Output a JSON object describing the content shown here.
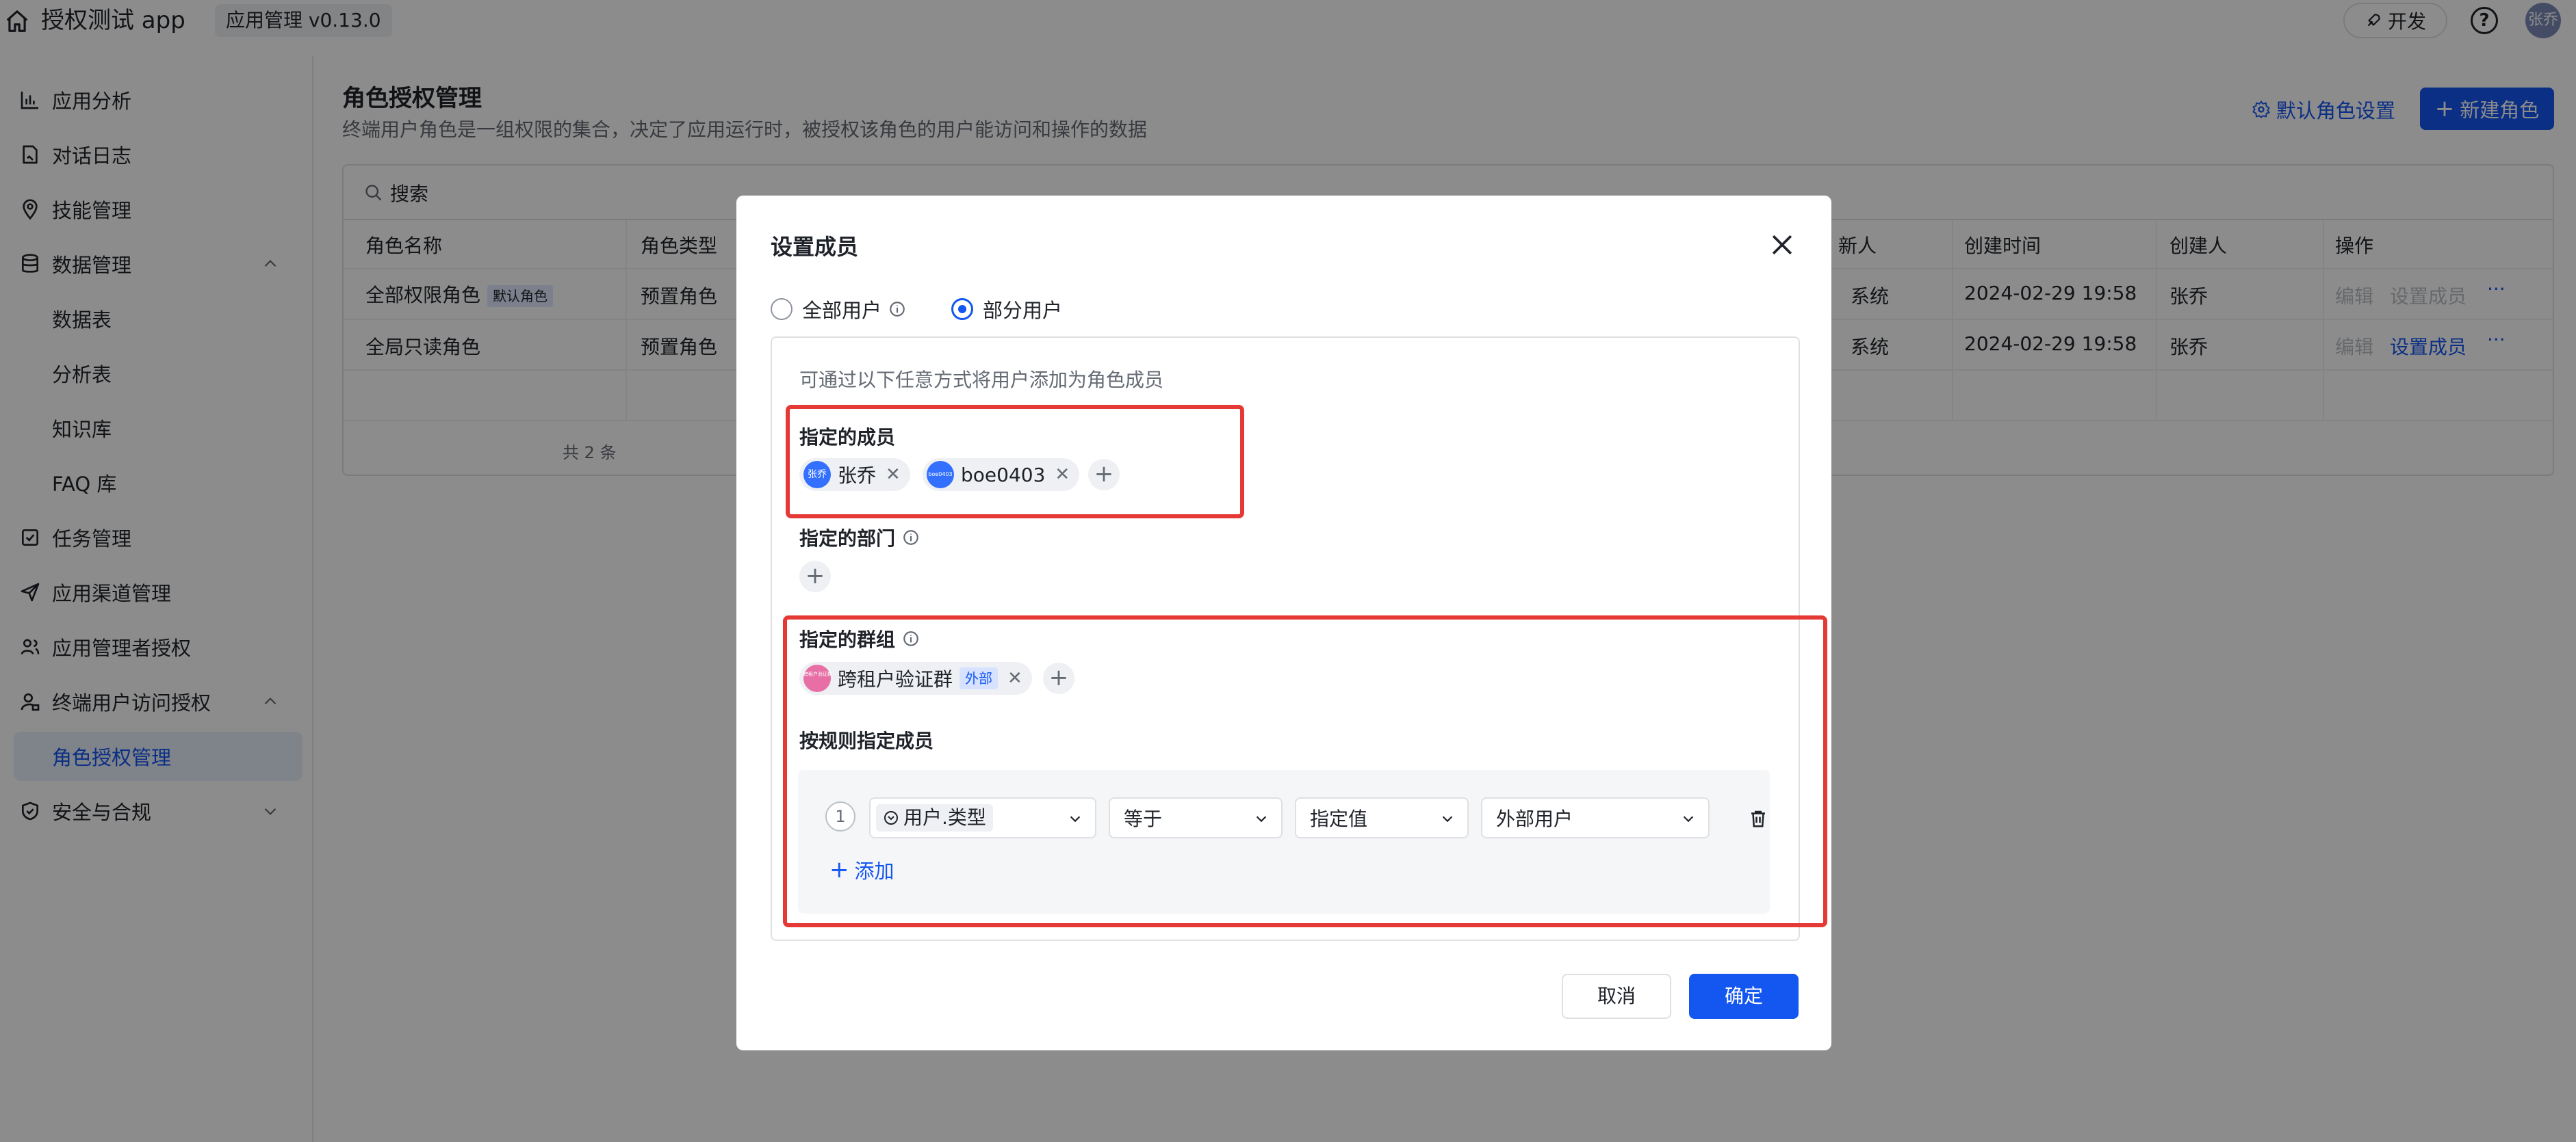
{
  "topbar": {
    "app_title": "授权测试 app",
    "version_tag": "应用管理 v0.13.0",
    "dev_button": "开发",
    "help": "?",
    "avatar_text": "张乔"
  },
  "sidebar": {
    "items": [
      {
        "label": "应用分析",
        "icon": "bar-chart-icon"
      },
      {
        "label": "对话日志",
        "icon": "log-icon"
      },
      {
        "label": "技能管理",
        "icon": "location-icon"
      },
      {
        "label": "数据管理",
        "icon": "database-icon",
        "expanded": true
      },
      {
        "label": "数据表"
      },
      {
        "label": "分析表"
      },
      {
        "label": "知识库"
      },
      {
        "label": "FAQ 库"
      },
      {
        "label": "任务管理",
        "icon": "checkbox-icon"
      },
      {
        "label": "应用渠道管理",
        "icon": "send-icon"
      },
      {
        "label": "应用管理者授权",
        "icon": "users-icon"
      },
      {
        "label": "终端用户访问授权",
        "icon": "user-lock-icon",
        "expanded": true
      },
      {
        "label": "角色授权管理",
        "active": true
      },
      {
        "label": "安全与合规",
        "icon": "shield-icon",
        "expanded": false
      }
    ]
  },
  "main": {
    "title": "角色授权管理",
    "description": "终端用户角色是一组权限的集合，决定了应用运行时，被授权该角色的用户能访问和操作的数据",
    "default_role_link": "默认角色设置",
    "new_role_button": "新建角色",
    "search_placeholder": "搜索",
    "table": {
      "headers": [
        "角色名称",
        "角色类型",
        "新人",
        "创建时间",
        "创建人",
        "操作"
      ],
      "rows": [
        {
          "name": "全部权限角色",
          "badge": "默认角色",
          "type": "预置角色",
          "source": "系统",
          "created": "2024-02-29 19:58",
          "creator": "张乔",
          "actions": [
            "编辑",
            "设置成员",
            "···"
          ]
        },
        {
          "name": "全局只读角色",
          "badge": "",
          "type": "预置角色",
          "source": "系统",
          "created": "2024-02-29 19:58",
          "creator": "张乔",
          "actions": [
            "编辑",
            "设置成员",
            "···"
          ]
        }
      ],
      "total": "共 2 条"
    }
  },
  "modal": {
    "title": "设置成员",
    "radio_all": "全部用户",
    "radio_partial": "部分用户",
    "selected_radio": "部分用户",
    "hint": "可通过以下任意方式将用户添加为角色成员",
    "members_label": "指定的成员",
    "members": [
      {
        "name": "张乔",
        "avatar": "张乔",
        "avatar_color": "#3370ff"
      },
      {
        "name": "boe0403",
        "avatar": "boe0403",
        "avatar_color": "#3370ff"
      }
    ],
    "departments_label": "指定的部门",
    "groups_label": "指定的群组",
    "groups": [
      {
        "name": "跨租户验证群",
        "tag": "外部",
        "avatar": "跨租户验证群",
        "avatar_color": "#e86fa6"
      }
    ],
    "rules_label": "按规则指定成员",
    "rule": {
      "index": "1",
      "field": "用户.类型",
      "operator": "等于",
      "value_type": "指定值",
      "value": "外部用户"
    },
    "add_rule": "添加",
    "cancel": "取消",
    "ok": "确定",
    "colors": {
      "primary": "#1456f0",
      "highlight": "#e53935"
    }
  }
}
